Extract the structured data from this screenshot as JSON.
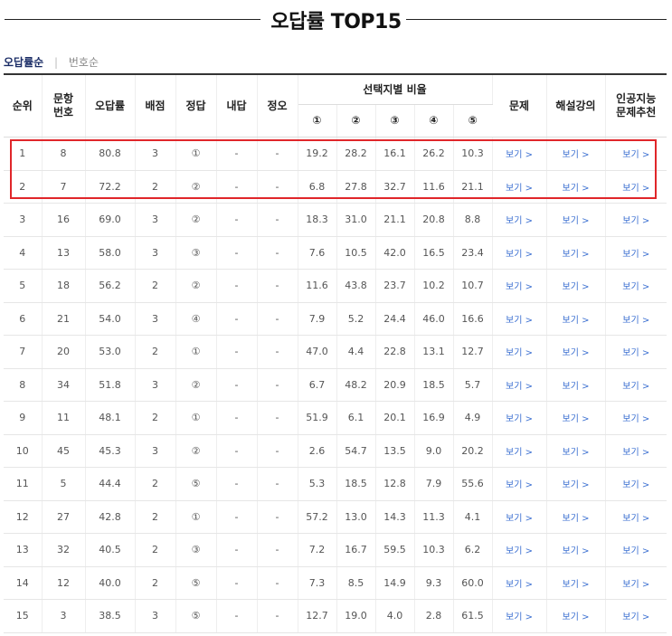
{
  "title": "오답률 TOP15",
  "sort": {
    "active": "오답률순",
    "separator": "|",
    "inactive": "번호순"
  },
  "headers": {
    "rank": "순위",
    "qnum_line1": "문항",
    "qnum_line2": "번호",
    "error_rate": "오답률",
    "points": "배점",
    "answer": "정답",
    "my_answer": "내답",
    "correct": "정오",
    "choice_ratio": "선택지별 비율",
    "choices": [
      "①",
      "②",
      "③",
      "④",
      "⑤"
    ],
    "problem": "문제",
    "lecture": "해설강의",
    "ai_line1": "인공지능",
    "ai_line2": "문제추천"
  },
  "link_label": "보기 >",
  "rows": [
    {
      "rank": "1",
      "qnum": "8",
      "rate": "80.8",
      "points": "3",
      "answer": "①",
      "mine": "-",
      "ox": "-",
      "ratios": [
        "19.2",
        "28.2",
        "16.1",
        "26.2",
        "10.3"
      ]
    },
    {
      "rank": "2",
      "qnum": "7",
      "rate": "72.2",
      "points": "2",
      "answer": "②",
      "mine": "-",
      "ox": "-",
      "ratios": [
        "6.8",
        "27.8",
        "32.7",
        "11.6",
        "21.1"
      ]
    },
    {
      "rank": "3",
      "qnum": "16",
      "rate": "69.0",
      "points": "3",
      "answer": "②",
      "mine": "-",
      "ox": "-",
      "ratios": [
        "18.3",
        "31.0",
        "21.1",
        "20.8",
        "8.8"
      ]
    },
    {
      "rank": "4",
      "qnum": "13",
      "rate": "58.0",
      "points": "3",
      "answer": "③",
      "mine": "-",
      "ox": "-",
      "ratios": [
        "7.6",
        "10.5",
        "42.0",
        "16.5",
        "23.4"
      ]
    },
    {
      "rank": "5",
      "qnum": "18",
      "rate": "56.2",
      "points": "2",
      "answer": "②",
      "mine": "-",
      "ox": "-",
      "ratios": [
        "11.6",
        "43.8",
        "23.7",
        "10.2",
        "10.7"
      ]
    },
    {
      "rank": "6",
      "qnum": "21",
      "rate": "54.0",
      "points": "3",
      "answer": "④",
      "mine": "-",
      "ox": "-",
      "ratios": [
        "7.9",
        "5.2",
        "24.4",
        "46.0",
        "16.6"
      ]
    },
    {
      "rank": "7",
      "qnum": "20",
      "rate": "53.0",
      "points": "2",
      "answer": "①",
      "mine": "-",
      "ox": "-",
      "ratios": [
        "47.0",
        "4.4",
        "22.8",
        "13.1",
        "12.7"
      ]
    },
    {
      "rank": "8",
      "qnum": "34",
      "rate": "51.8",
      "points": "3",
      "answer": "②",
      "mine": "-",
      "ox": "-",
      "ratios": [
        "6.7",
        "48.2",
        "20.9",
        "18.5",
        "5.7"
      ]
    },
    {
      "rank": "9",
      "qnum": "11",
      "rate": "48.1",
      "points": "2",
      "answer": "①",
      "mine": "-",
      "ox": "-",
      "ratios": [
        "51.9",
        "6.1",
        "20.1",
        "16.9",
        "4.9"
      ]
    },
    {
      "rank": "10",
      "qnum": "45",
      "rate": "45.3",
      "points": "3",
      "answer": "②",
      "mine": "-",
      "ox": "-",
      "ratios": [
        "2.6",
        "54.7",
        "13.5",
        "9.0",
        "20.2"
      ]
    },
    {
      "rank": "11",
      "qnum": "5",
      "rate": "44.4",
      "points": "2",
      "answer": "⑤",
      "mine": "-",
      "ox": "-",
      "ratios": [
        "5.3",
        "18.5",
        "12.8",
        "7.9",
        "55.6"
      ]
    },
    {
      "rank": "12",
      "qnum": "27",
      "rate": "42.8",
      "points": "2",
      "answer": "①",
      "mine": "-",
      "ox": "-",
      "ratios": [
        "57.2",
        "13.0",
        "14.3",
        "11.3",
        "4.1"
      ]
    },
    {
      "rank": "13",
      "qnum": "32",
      "rate": "40.5",
      "points": "2",
      "answer": "③",
      "mine": "-",
      "ox": "-",
      "ratios": [
        "7.2",
        "16.7",
        "59.5",
        "10.3",
        "6.2"
      ]
    },
    {
      "rank": "14",
      "qnum": "12",
      "rate": "40.0",
      "points": "2",
      "answer": "⑤",
      "mine": "-",
      "ox": "-",
      "ratios": [
        "7.3",
        "8.5",
        "14.9",
        "9.3",
        "60.0"
      ]
    },
    {
      "rank": "15",
      "qnum": "3",
      "rate": "38.5",
      "points": "3",
      "answer": "⑤",
      "mine": "-",
      "ox": "-",
      "ratios": [
        "12.7",
        "19.0",
        "4.0",
        "2.8",
        "61.5"
      ]
    }
  ],
  "colors": {
    "highlight": "#e0262a",
    "link": "#3b6fd1",
    "sort_active": "#1a2c66",
    "ox_dash": "#d33"
  }
}
